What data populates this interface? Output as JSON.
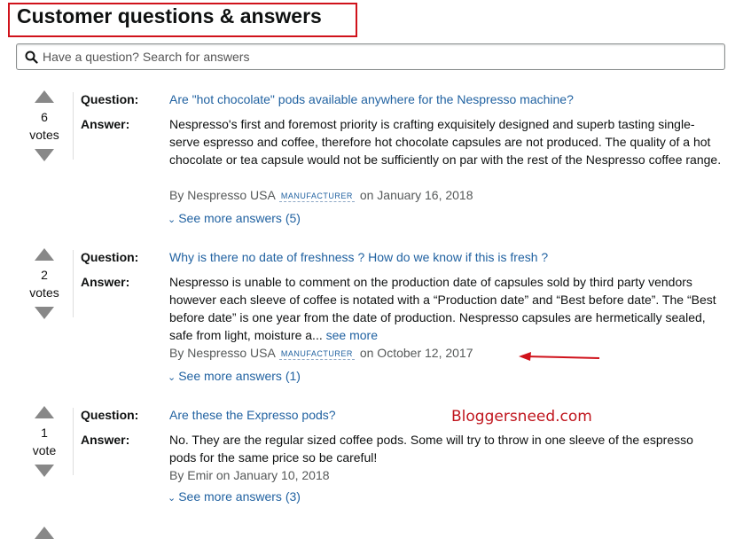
{
  "header": {
    "title": "Customer questions & answers"
  },
  "search": {
    "placeholder": "Have a question? Search for answers"
  },
  "labels": {
    "question": "Question:",
    "answer": "Answer:"
  },
  "items": [
    {
      "votes": "6",
      "votes_label": "votes",
      "question": "Are \"hot chocolate\" pods available anywhere for the Nespresso machine?",
      "answer": "Nespresso's first and foremost priority is crafting exquisitely designed and superb tasting single-serve espresso and coffee, therefore hot chocolate capsules are not produced. The quality of a hot chocolate or tea capsule would not be sufficiently on par with the rest of the Nespresso coffee range.",
      "author": "By Nespresso USA",
      "badge": "MANUFACTURER",
      "date": "on January 16, 2018",
      "see_more": "See more answers (5)"
    },
    {
      "votes": "2",
      "votes_label": "votes",
      "question": "Why is there no date of freshness ? How do we know if this is fresh ?",
      "answer": "Nespresso is unable to comment on the production date of capsules sold by third party vendors however each sleeve of coffee is notated with a “Production date” and “Best before date”. The “Best before date” is one year from the date of production. Nespresso capsules are hermetically sealed, safe from light, moisture a...",
      "answer_link": "see more",
      "author": "By Nespresso USA",
      "badge": "MANUFACTURER",
      "date": "on October 12, 2017",
      "see_more": "See more answers (1)"
    },
    {
      "votes": "1",
      "votes_label": "vote",
      "question": "Are these the Expresso pods?",
      "answer": "No. They are the regular sized coffee pods. Some will try to throw in one sleeve of the espresso pods for the same price so be careful!",
      "author": "By Emir on January 10, 2018",
      "see_more": "See more answers (3)"
    }
  ],
  "watermark": "Bloggersneed.com",
  "colors": {
    "link": "#2162a1",
    "annotation_red": "#d0121b"
  }
}
